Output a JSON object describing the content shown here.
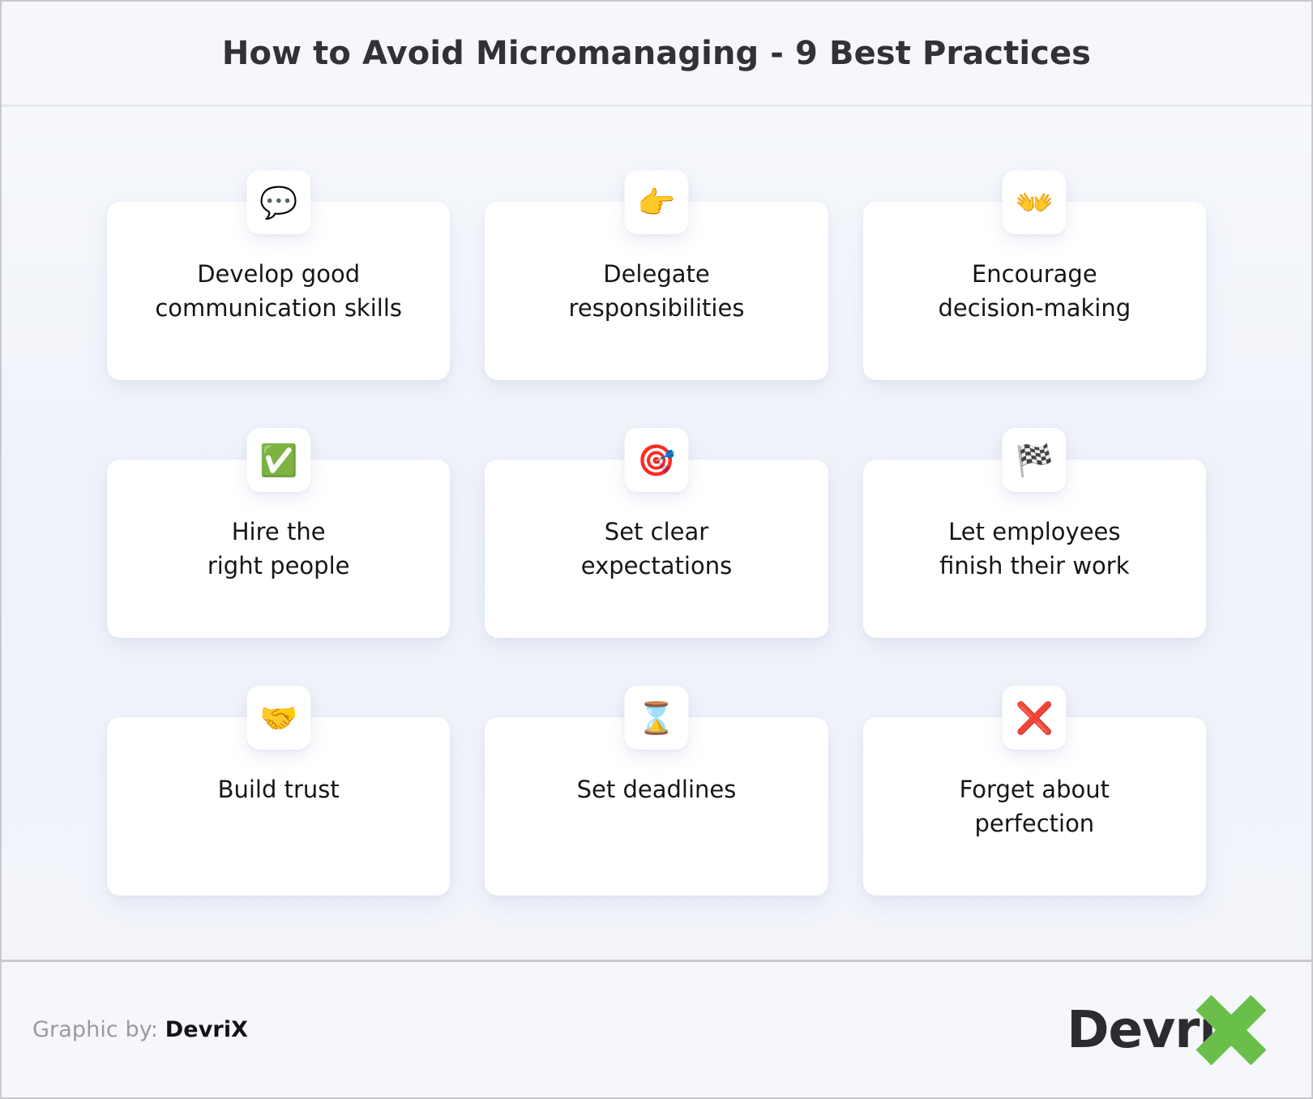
{
  "header": {
    "title": "How to Avoid Micromanaging - 9 Best Practices"
  },
  "cards": [
    {
      "icon": "speech-balloon",
      "glyph": "💬",
      "label": "Develop good\ncommunication skills"
    },
    {
      "icon": "pointing-right-hand",
      "glyph": "👉",
      "label": "Delegate\nresponsibilities"
    },
    {
      "icon": "open-hands",
      "glyph": "👐",
      "label": "Encourage\ndecision-making"
    },
    {
      "icon": "check-mark-button",
      "glyph": "✅",
      "label": "Hire the\nright people"
    },
    {
      "icon": "bullseye-dart",
      "glyph": "🎯",
      "label": "Set clear\nexpectations"
    },
    {
      "icon": "chequered-flag",
      "glyph": "🏁",
      "label": "Let employees\nfinish their work"
    },
    {
      "icon": "handshake",
      "glyph": "🤝",
      "label": "Build trust"
    },
    {
      "icon": "hourglass",
      "glyph": "⌛",
      "label": "Set deadlines"
    },
    {
      "icon": "cross-mark",
      "glyph": "❌",
      "label": "Forget about\nperfection"
    }
  ],
  "footer": {
    "credit_prefix": "Graphic by: ",
    "credit_brand": "DevriX",
    "logo_word": "Devri",
    "logo_accent_letter": "X",
    "accent_color": "#6abf4b"
  }
}
